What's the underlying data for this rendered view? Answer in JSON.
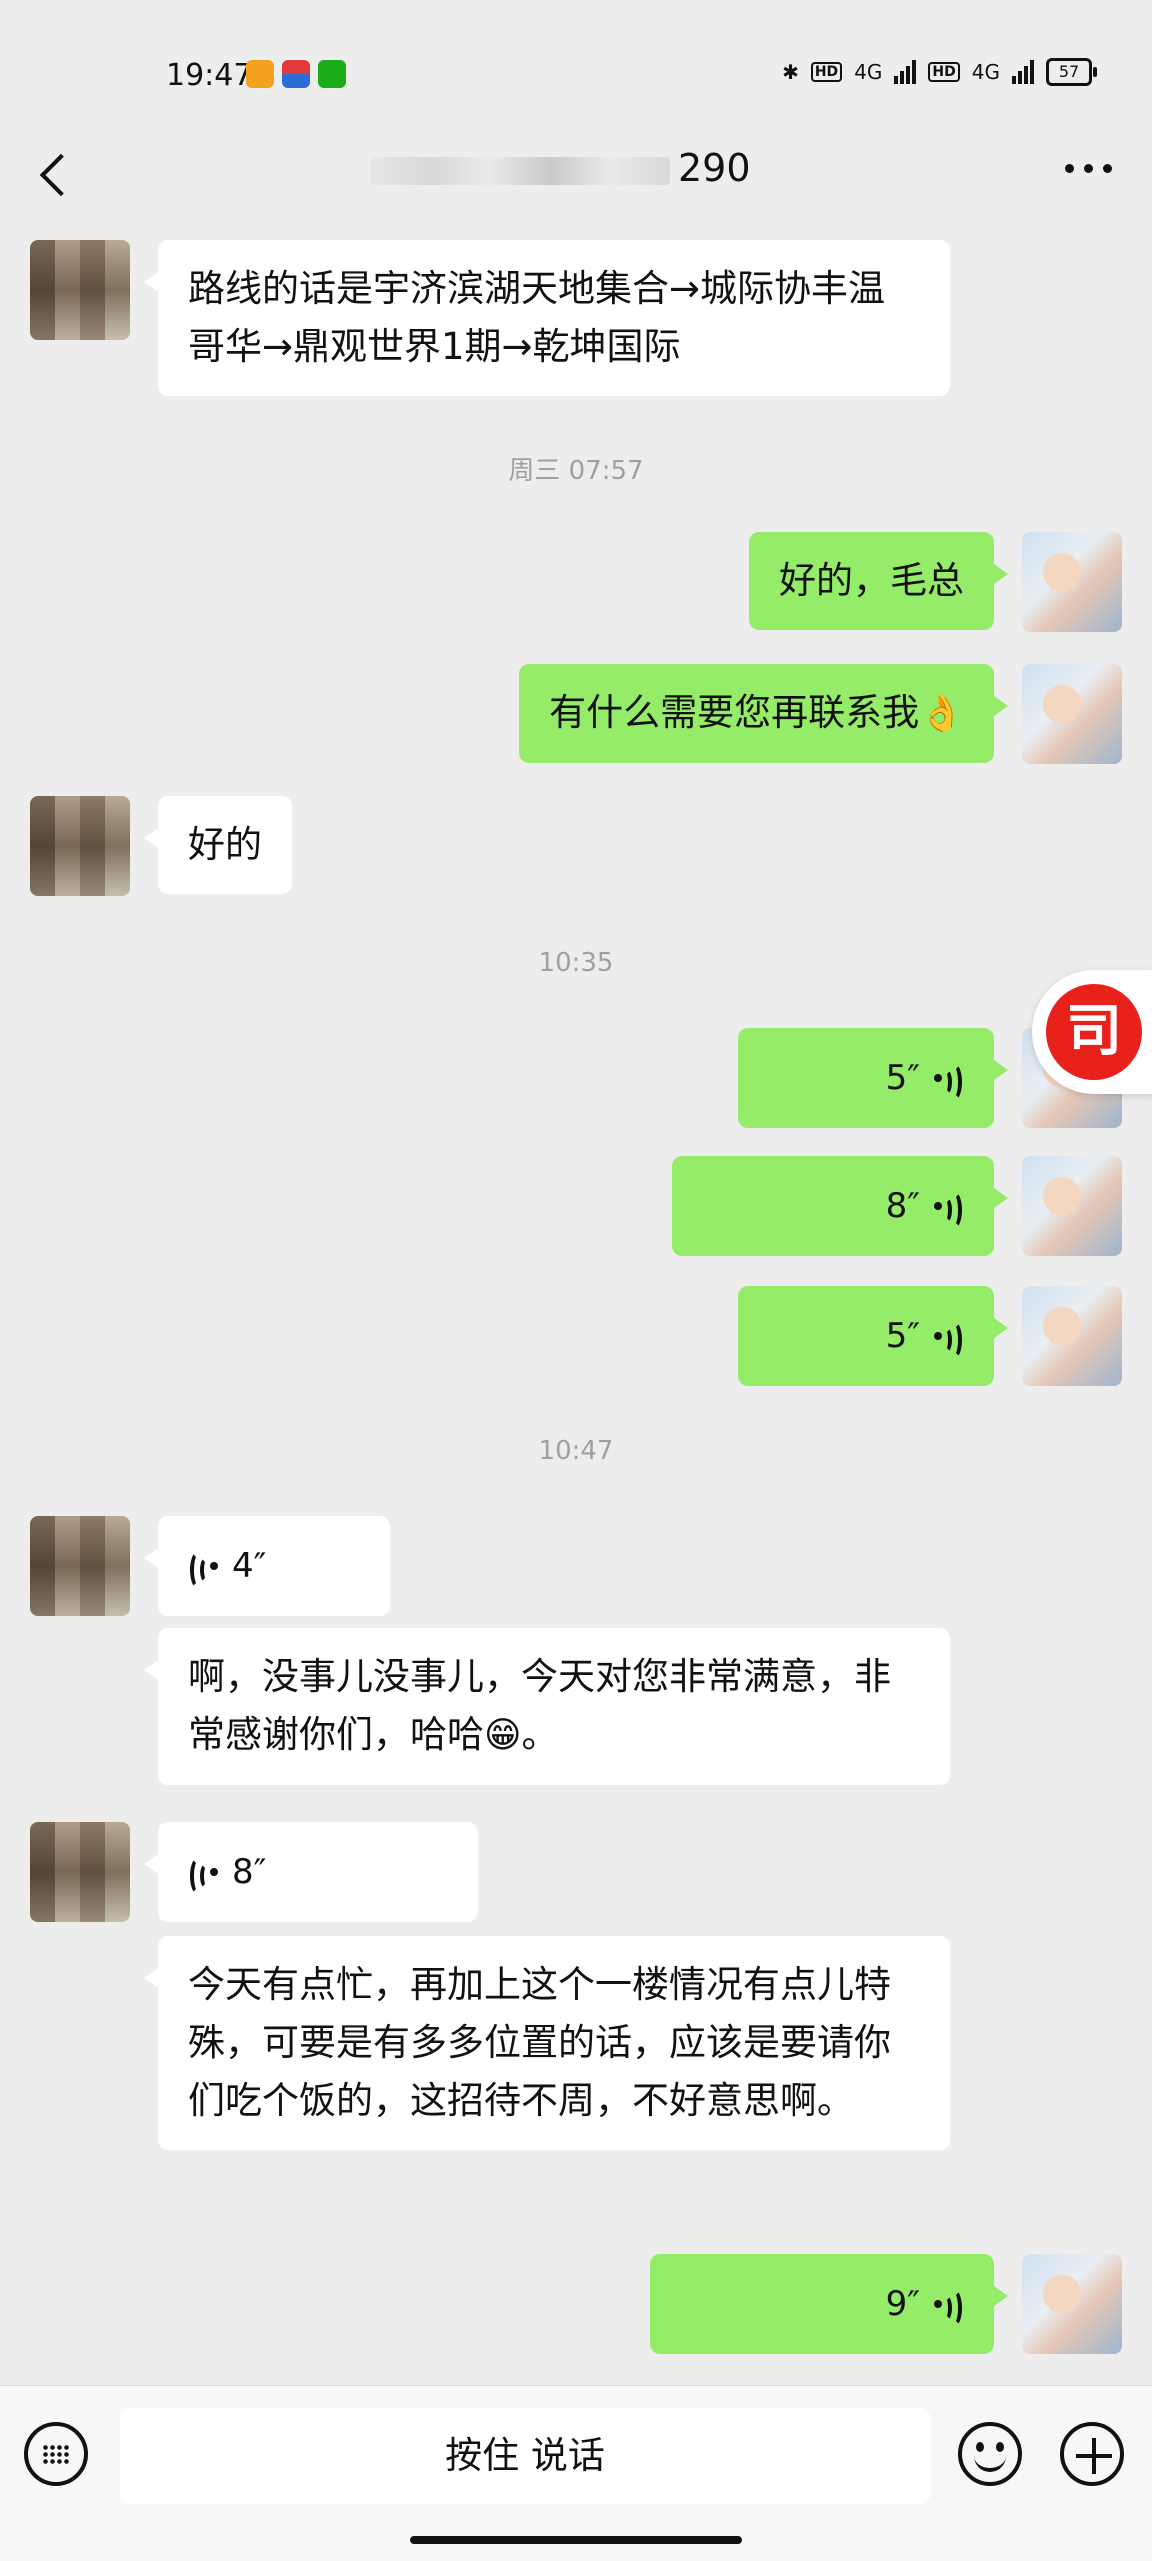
{
  "status_bar": {
    "time": "19:47",
    "network_1": "4G",
    "network_2": "4G",
    "hd": "HD",
    "battery": "57"
  },
  "header": {
    "title_suffix": "290",
    "back_icon": "chevron-left-icon",
    "more_icon": "ellipsis-icon"
  },
  "messages": [
    {
      "side": "left",
      "type": "text",
      "text": "路线的话是宇济滨湖天地集合→城际协丰温哥华→鼎观世界1期→乾坤国际"
    },
    {
      "type": "timestamp",
      "text": "周三 07:57"
    },
    {
      "side": "right",
      "type": "text",
      "text": "好的，毛总"
    },
    {
      "side": "right",
      "type": "text",
      "text": "有什么需要您再联系我",
      "emoji": "👌"
    },
    {
      "side": "left",
      "type": "text",
      "text": "好的"
    },
    {
      "type": "timestamp",
      "text": "10:35"
    },
    {
      "side": "right",
      "type": "voice",
      "duration": "5″"
    },
    {
      "side": "right",
      "type": "voice",
      "duration": "8″"
    },
    {
      "side": "right",
      "type": "voice",
      "duration": "5″"
    },
    {
      "type": "timestamp",
      "text": "10:47"
    },
    {
      "side": "left",
      "type": "voice",
      "duration": "4″"
    },
    {
      "side": "left",
      "type": "text",
      "text": "啊，没事儿没事儿，今天对您非常满意，非常感谢你们，哈哈",
      "emoji": "😁",
      "suffix": "。"
    },
    {
      "side": "left",
      "type": "voice",
      "duration": "8″"
    },
    {
      "side": "left",
      "type": "text",
      "text": "今天有点忙，再加上这个一楼情况有点儿特殊，可要是有多多位置的话，应该是要请你们吃个饭的，这招待不周，不好意思啊。"
    },
    {
      "side": "right",
      "type": "voice",
      "duration": "9″"
    }
  ],
  "float_badge": {
    "glyph": "司"
  },
  "input_bar": {
    "hold_to_talk": "按住 说话",
    "keyboard_icon": "keyboard-icon",
    "emoji_icon": "emoji-icon",
    "plus_icon": "plus-icon"
  },
  "colors": {
    "sent_bubble": "#95ec69",
    "received_bubble": "#ffffff",
    "background": "#ededed"
  }
}
